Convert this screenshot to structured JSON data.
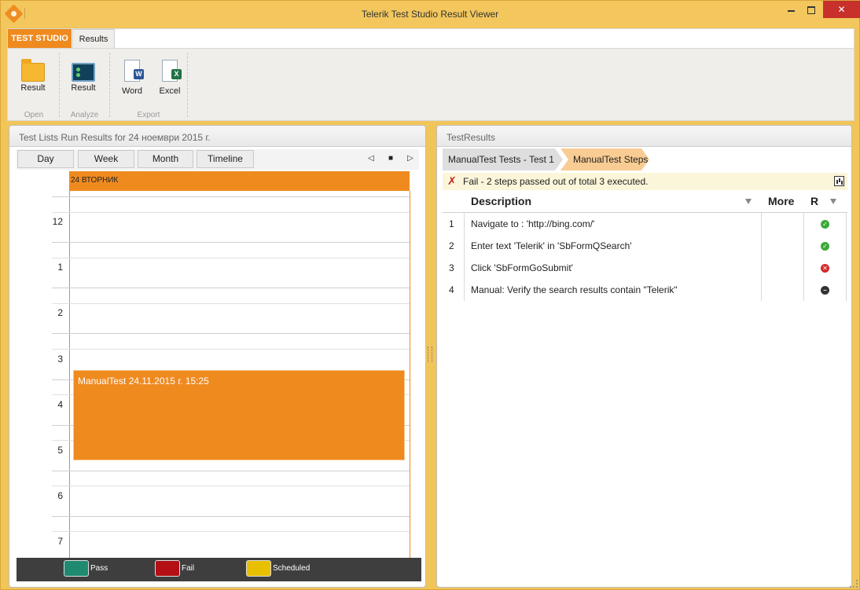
{
  "window": {
    "title": "Telerik Test Studio Result Viewer"
  },
  "ribbon": {
    "file_tab": "TEST STUDIO",
    "active_tab": "Results",
    "groups": [
      {
        "label": "Open",
        "buttons": [
          {
            "label": "Result",
            "icon": "folder-icon"
          }
        ]
      },
      {
        "label": "Analyze",
        "buttons": [
          {
            "label": "Result",
            "icon": "monitor-icon"
          }
        ]
      },
      {
        "label": "Export",
        "buttons": [
          {
            "label": "Word",
            "icon": "word-doc-icon"
          },
          {
            "label": "Excel",
            "icon": "excel-doc-icon"
          }
        ]
      }
    ]
  },
  "left_panel": {
    "title": "Test Lists Run Results for 24 ноември 2015 г.",
    "views": [
      "Day",
      "Week",
      "Month",
      "Timeline"
    ],
    "day_header": "24 ВТОРНИК",
    "hours": [
      "12",
      "1",
      "2",
      "3",
      "4",
      "5",
      "6",
      "7"
    ],
    "appointment": "ManualTest 24.11.2015 г. 15:25",
    "legend": [
      {
        "label": "Pass",
        "color": "#1f8a70"
      },
      {
        "label": "Fail",
        "color": "#b30f14"
      },
      {
        "label": "Scheduled",
        "color": "#e8c000"
      }
    ]
  },
  "right_panel": {
    "title": "TestResults",
    "breadcrumbs": [
      "ManualTest Tests - Test 1",
      "ManualTest Steps"
    ],
    "status": "Fail - 2 steps passed out of total 3 executed.",
    "columns": {
      "description": "Description",
      "more": "More",
      "result": "R"
    },
    "steps": [
      {
        "n": "1",
        "description": "Navigate to : 'http://bing.com/'",
        "result": "pass"
      },
      {
        "n": "2",
        "description": "Enter text 'Telerik' in 'SbFormQSearch'",
        "result": "pass"
      },
      {
        "n": "3",
        "description": "Click 'SbFormGoSubmit'",
        "result": "fail"
      },
      {
        "n": "4",
        "description": "Manual: Verify the search results contain \"Telerik\"",
        "result": "not-run"
      }
    ]
  }
}
